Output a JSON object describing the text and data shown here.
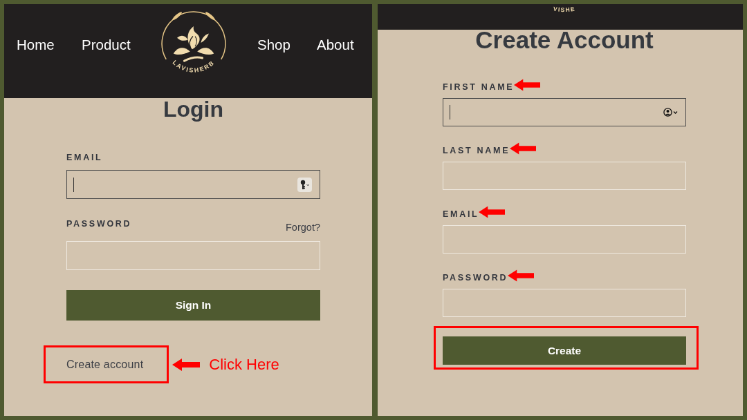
{
  "login_panel": {
    "header": {
      "nav_left": [
        {
          "label": "Home"
        },
        {
          "label": "Product"
        }
      ],
      "logo_text": "LAVISHERB",
      "nav_right": [
        {
          "label": "Shop"
        },
        {
          "label": "About"
        }
      ]
    },
    "title": "Login",
    "fields": [
      {
        "label": "EMAIL",
        "focused": true
      },
      {
        "label": "PASSWORD",
        "focused": false,
        "link": "Forgot?"
      }
    ],
    "submit_button": {
      "label": "Sign In",
      "highlighted": false
    },
    "create_account_link": {
      "label": "Create account",
      "highlighted": true
    },
    "callout": "Click Here"
  },
  "signup_panel": {
    "header": {
      "logo_text": "VISHE"
    },
    "title": "Create Account",
    "fields": [
      {
        "label": "FIRST NAME",
        "focused": true,
        "annotated": true
      },
      {
        "label": "LAST NAME",
        "focused": false,
        "annotated": true
      },
      {
        "label": "EMAIL",
        "focused": false,
        "annotated": true
      },
      {
        "label": "PASSWORD",
        "focused": false,
        "annotated": true
      }
    ],
    "submit_button": {
      "label": "Create",
      "highlighted": true
    }
  }
}
